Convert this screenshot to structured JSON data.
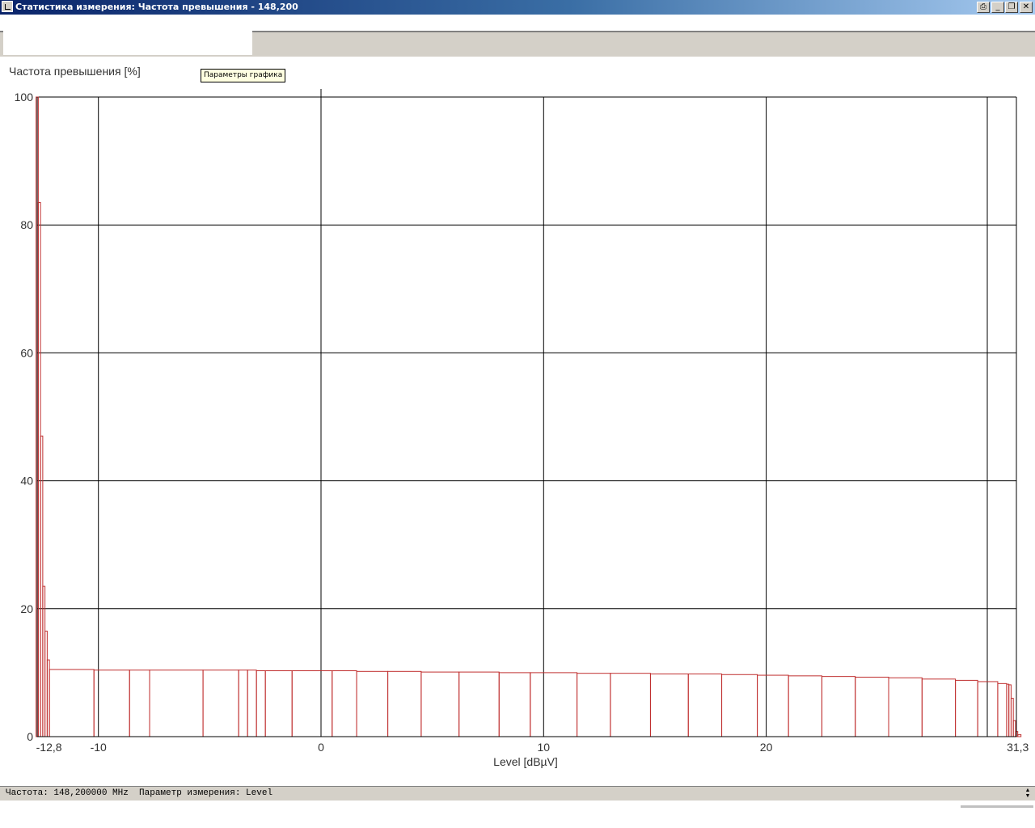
{
  "window": {
    "title": "Статистика измерения: Частота превышения  - 148,200"
  },
  "tooltip": {
    "text": "Параметры графика"
  },
  "status": {
    "text": "Частота: 148,200000 MHz  Параметр измерения: Level"
  },
  "chart_data": {
    "type": "bar",
    "ylabel": "Частота превышения [%]",
    "xlabel": "Level [dBµV]",
    "xlim": [
      -12.8,
      31.3
    ],
    "ylim": [
      0,
      100
    ],
    "x_ticks": [
      "-12,8",
      "-10",
      "0",
      "10",
      "20",
      "31,3"
    ],
    "x_tick_values": [
      -12.8,
      -10,
      0,
      10,
      20,
      31.3
    ],
    "y_ticks": [
      "0",
      "20",
      "40",
      "60",
      "80",
      "100"
    ],
    "y_tick_values": [
      0,
      20,
      40,
      60,
      80,
      100
    ],
    "grid": true,
    "colors": {
      "series": "#c03030",
      "grid": "#000000"
    },
    "series": [
      {
        "x": [
          -12.8,
          -12.7,
          -12.6,
          -12.5,
          -12.4,
          -12.3,
          -12.2,
          -10.2,
          -8.6,
          -7.7,
          -5.3,
          -3.7,
          -3.3,
          -2.9,
          -2.5,
          -1.3,
          0.5,
          1.6,
          3.0,
          4.5,
          6.2,
          8.0,
          9.4,
          11.5,
          13.0,
          14.8,
          16.5,
          18.0,
          19.6,
          21.0,
          22.5,
          24.0,
          25.5,
          27.0,
          28.5,
          29.5,
          30.4,
          30.8,
          30.9,
          31.0,
          31.1,
          31.2,
          31.3
        ],
        "values": [
          100,
          83.5,
          47,
          23.5,
          16.5,
          12,
          10.5,
          10.4,
          10.4,
          10.4,
          10.4,
          10.4,
          10.4,
          10.3,
          10.3,
          10.3,
          10.3,
          10.2,
          10.2,
          10.1,
          10.1,
          10.0,
          10.0,
          9.9,
          9.9,
          9.8,
          9.8,
          9.7,
          9.6,
          9.5,
          9.4,
          9.3,
          9.2,
          9.0,
          8.8,
          8.6,
          8.3,
          8.2,
          8.1,
          6.0,
          2.5,
          0.8,
          0.3
        ]
      }
    ]
  }
}
